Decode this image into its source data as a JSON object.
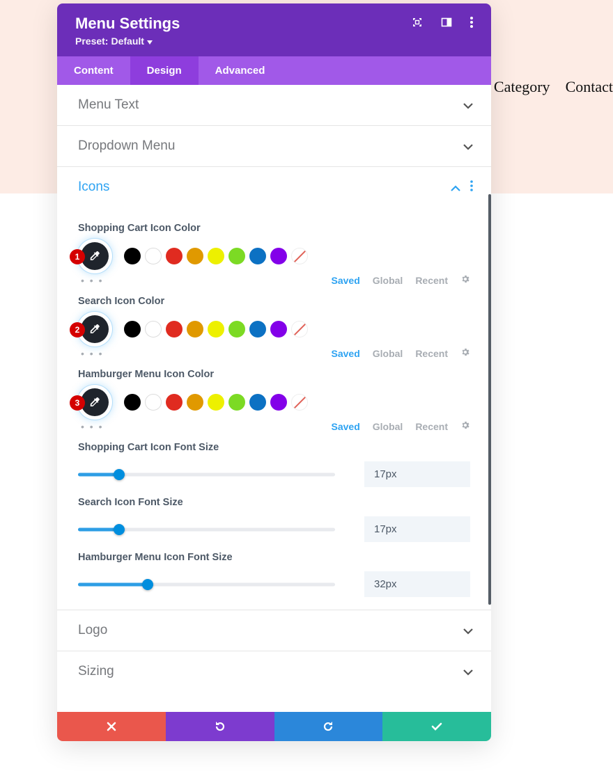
{
  "nav": {
    "category": "Category",
    "contact": "Contact"
  },
  "header": {
    "title": "Menu Settings",
    "preset_prefix": "Preset:",
    "preset_value": "Default"
  },
  "tabs": {
    "content": "Content",
    "design": "Design",
    "advanced": "Advanced",
    "active": "design"
  },
  "sections": {
    "menu_text": "Menu Text",
    "dropdown_menu": "Dropdown Menu",
    "icons": "Icons",
    "logo": "Logo",
    "sizing": "Sizing"
  },
  "icons_panel": {
    "color_rows": [
      {
        "label": "Shopping Cart Icon Color",
        "badge": "1"
      },
      {
        "label": "Search Icon Color",
        "badge": "2"
      },
      {
        "label": "Hamburger Menu Icon Color",
        "badge": "3"
      }
    ],
    "meta_tabs": {
      "saved": "Saved",
      "global": "Global",
      "recent": "Recent"
    },
    "size_rows": [
      {
        "label": "Shopping Cart Icon Font Size",
        "value": "17px",
        "fill_pct": 16
      },
      {
        "label": "Search Icon Font Size",
        "value": "17px",
        "fill_pct": 16
      },
      {
        "label": "Hamburger Menu Icon Font Size",
        "value": "32px",
        "fill_pct": 27
      }
    ]
  },
  "swatch_names": [
    "black",
    "white",
    "red",
    "orange",
    "yellow",
    "green",
    "blue",
    "purple",
    "none"
  ]
}
